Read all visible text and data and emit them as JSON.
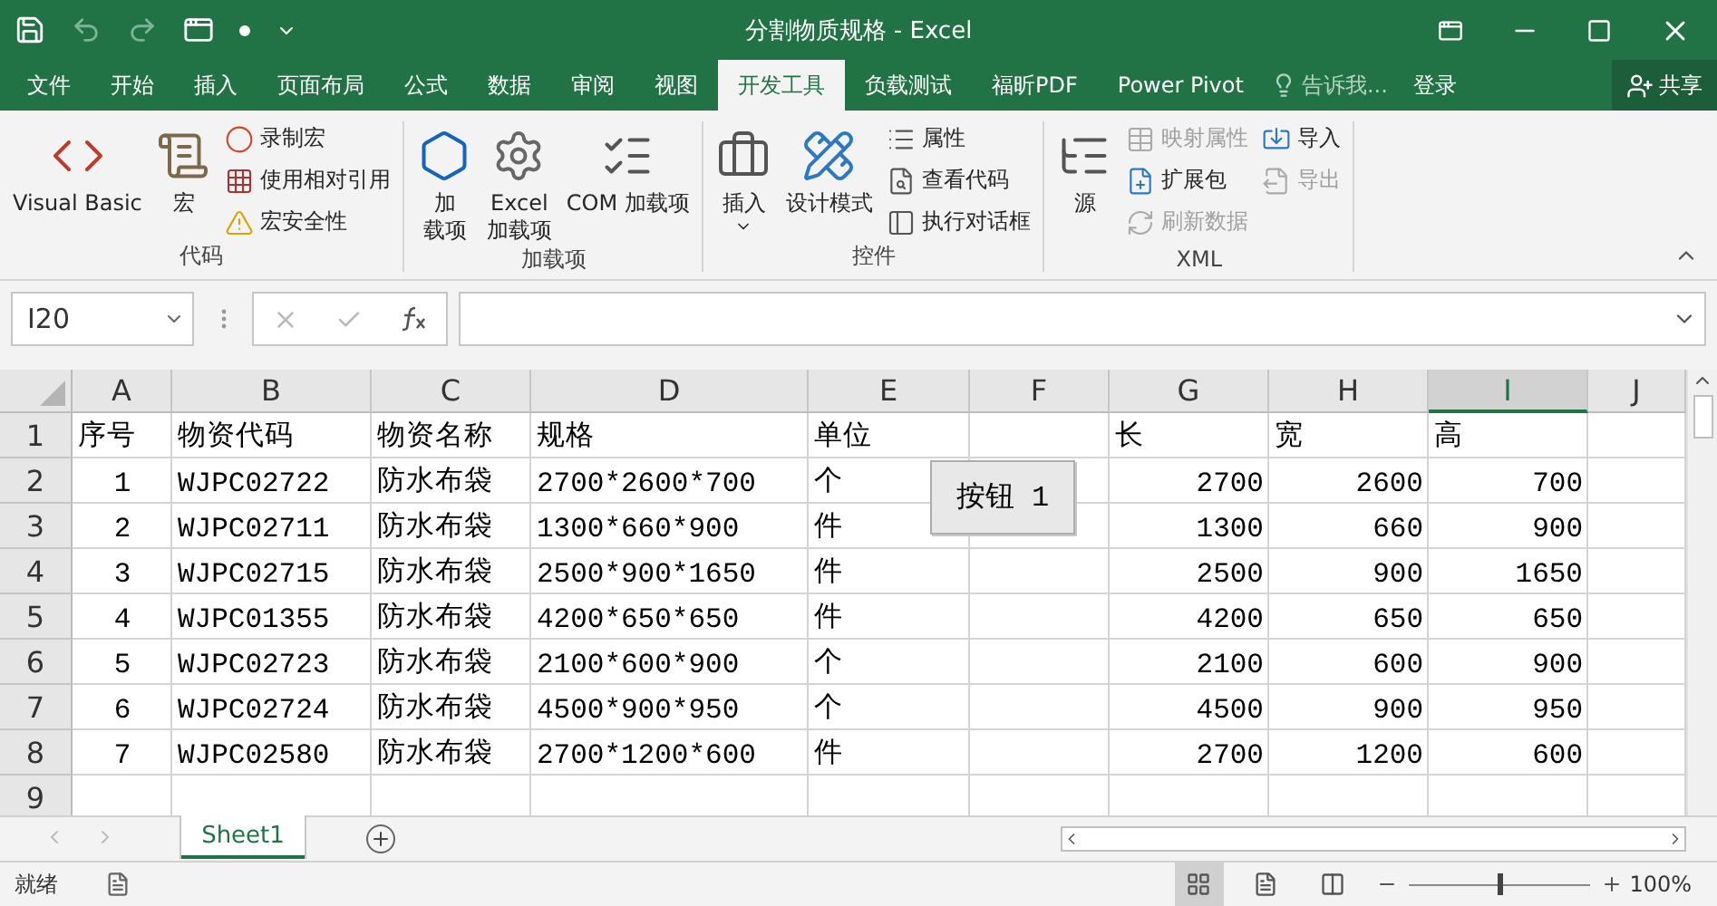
{
  "window": {
    "title": "分割物质规格 - Excel"
  },
  "tabs": [
    {
      "label": "文件",
      "selected": false
    },
    {
      "label": "开始",
      "selected": false
    },
    {
      "label": "插入",
      "selected": false
    },
    {
      "label": "页面布局",
      "selected": false
    },
    {
      "label": "公式",
      "selected": false
    },
    {
      "label": "数据",
      "selected": false
    },
    {
      "label": "审阅",
      "selected": false
    },
    {
      "label": "视图",
      "selected": false
    },
    {
      "label": "开发工具",
      "selected": true
    },
    {
      "label": "负载测试",
      "selected": false
    },
    {
      "label": "福昕PDF",
      "selected": false
    },
    {
      "label": "Power Pivot",
      "selected": false
    }
  ],
  "tell_me": {
    "placeholder": "告诉我..."
  },
  "sign_in": "登录",
  "share": "共享",
  "ribbon_groups": [
    {
      "label": "代码",
      "items": [
        {
          "kind": "large",
          "lines": [
            "Visual Basic"
          ],
          "disabled": false
        },
        {
          "kind": "large",
          "lines": [
            "宏"
          ],
          "disabled": false
        },
        {
          "kind": "small",
          "lines": [
            "录制宏"
          ],
          "disabled": false
        },
        {
          "kind": "small",
          "lines": [
            "使用相对引用"
          ],
          "disabled": false
        },
        {
          "kind": "small",
          "lines": [
            "宏安全性"
          ],
          "disabled": false
        }
      ]
    },
    {
      "label": "加载项",
      "items": [
        {
          "kind": "large",
          "lines": [
            "加",
            "载项"
          ],
          "disabled": false
        },
        {
          "kind": "large",
          "lines": [
            "Excel",
            "加载项"
          ],
          "disabled": false
        },
        {
          "kind": "large",
          "lines": [
            "COM 加载项"
          ],
          "disabled": false
        }
      ]
    },
    {
      "label": "控件",
      "items": [
        {
          "kind": "large",
          "lines": [
            "插入"
          ],
          "dropdown": true,
          "disabled": false
        },
        {
          "kind": "large",
          "lines": [
            "设计模式"
          ],
          "disabled": false
        },
        {
          "kind": "small",
          "lines": [
            "属性"
          ],
          "disabled": false
        },
        {
          "kind": "small",
          "lines": [
            "查看代码"
          ],
          "disabled": false
        },
        {
          "kind": "small",
          "lines": [
            "执行对话框"
          ],
          "disabled": false
        }
      ]
    },
    {
      "label": "XML",
      "items": [
        {
          "kind": "large",
          "lines": [
            "源"
          ],
          "disabled": false
        },
        {
          "kind": "small",
          "lines": [
            "映射属性"
          ],
          "disabled": true
        },
        {
          "kind": "small",
          "lines": [
            "扩展包"
          ],
          "disabled": false
        },
        {
          "kind": "small",
          "lines": [
            "刷新数据"
          ],
          "disabled": true
        },
        {
          "kind": "small",
          "lines": [
            "导入"
          ],
          "disabled": false
        },
        {
          "kind": "small",
          "lines": [
            "导出"
          ],
          "disabled": true
        }
      ]
    }
  ],
  "name_box": "I20",
  "columns": [
    {
      "letter": "A",
      "selected": false
    },
    {
      "letter": "B",
      "selected": false
    },
    {
      "letter": "C",
      "selected": false
    },
    {
      "letter": "D",
      "selected": false
    },
    {
      "letter": "E",
      "selected": false
    },
    {
      "letter": "F",
      "selected": false
    },
    {
      "letter": "G",
      "selected": false
    },
    {
      "letter": "H",
      "selected": false
    },
    {
      "letter": "I",
      "selected": true
    },
    {
      "letter": "J",
      "selected": false
    }
  ],
  "rows": [
    {
      "number": "1",
      "cells": [
        "序号",
        "物资代码",
        "物资名称",
        "规格",
        "单位",
        null,
        "长",
        "宽",
        "高"
      ]
    },
    {
      "number": "2",
      "cells": [
        "1",
        "WJPC02722",
        "防水布袋",
        "2700*2600*700",
        "个",
        null,
        "2700",
        "2600",
        "700"
      ]
    },
    {
      "number": "3",
      "cells": [
        "2",
        "WJPC02711",
        "防水布袋",
        "1300*660*900",
        "件",
        null,
        "1300",
        "660",
        "900"
      ]
    },
    {
      "number": "4",
      "cells": [
        "3",
        "WJPC02715",
        "防水布袋",
        "2500*900*1650",
        "件",
        null,
        "2500",
        "900",
        "1650"
      ]
    },
    {
      "number": "5",
      "cells": [
        "4",
        "WJPC01355",
        "防水布袋",
        "4200*650*650",
        "件",
        null,
        "4200",
        "650",
        "650"
      ]
    },
    {
      "number": "6",
      "cells": [
        "5",
        "WJPC02723",
        "防水布袋",
        "2100*600*900",
        "个",
        null,
        "2100",
        "600",
        "900"
      ]
    },
    {
      "number": "7",
      "cells": [
        "6",
        "WJPC02724",
        "防水布袋",
        "4500*900*950",
        "个",
        null,
        "4500",
        "900",
        "950"
      ]
    },
    {
      "number": "8",
      "cells": [
        "7",
        "WJPC02580",
        "防水布袋",
        "2700*1200*600",
        "件",
        null,
        "2700",
        "1200",
        "600"
      ]
    },
    {
      "number": "9",
      "cells": []
    }
  ],
  "form_button": "按钮 1",
  "sheet_tabs": [
    {
      "label": "Sheet1",
      "selected": true
    }
  ],
  "status": "就绪",
  "views": [
    {
      "selected": true
    },
    {
      "selected": false
    },
    {
      "selected": false
    }
  ],
  "zoom": {
    "level": 0.5,
    "reading": "100%"
  }
}
